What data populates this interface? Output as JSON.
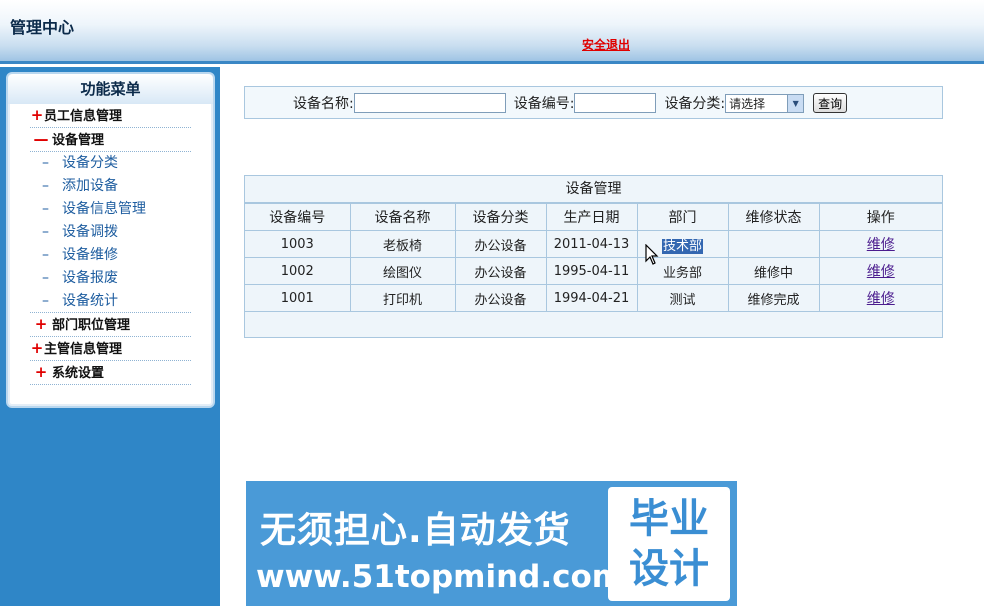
{
  "header": {
    "title": "管理中心",
    "logout_label": "安全退出"
  },
  "sidebar": {
    "title": "功能菜单",
    "groups": [
      {
        "sign": "+",
        "label": "员工信息管理"
      },
      {
        "sign": "—",
        "label": "设备管理"
      },
      {
        "sign": "+",
        "label": "部门职位管理"
      },
      {
        "sign": "+",
        "label": "主管信息管理"
      },
      {
        "sign": "+",
        "label": "系统设置"
      }
    ],
    "sub_items": [
      {
        "dash": "–",
        "label": "设备分类"
      },
      {
        "dash": "–",
        "label": "添加设备"
      },
      {
        "dash": "–",
        "label": "设备信息管理"
      },
      {
        "dash": "–",
        "label": "设备调拨"
      },
      {
        "dash": "–",
        "label": "设备维修"
      },
      {
        "dash": "–",
        "label": "设备报废"
      },
      {
        "dash": "–",
        "label": "设备统计"
      }
    ]
  },
  "search": {
    "name_label": "设备名称:",
    "name_value": "",
    "no_label": "设备编号:",
    "no_value": "",
    "category_label": "设备分类:",
    "category_selected": "请选择",
    "query_button": "查询"
  },
  "table": {
    "caption": "设备管理",
    "headers": [
      "设备编号",
      "设备名称",
      "设备分类",
      "生产日期",
      "部门",
      "维修状态",
      "操作"
    ],
    "rows": [
      [
        "1003",
        "老板椅",
        "办公设备",
        "2011-04-13",
        "技术部",
        "",
        "维修"
      ],
      [
        "1002",
        "绘图仪",
        "办公设备",
        "1995-04-11",
        "业务部",
        "维修中",
        "维修"
      ],
      [
        "1001",
        "打印机",
        "办公设备",
        "1994-04-21",
        "测试",
        "维修完成",
        "维修"
      ]
    ]
  },
  "banner": {
    "line1": "无须担心.自动发货",
    "line2": "www.51topmind.com",
    "badge_line1": "毕业",
    "badge_line2": "设计"
  }
}
